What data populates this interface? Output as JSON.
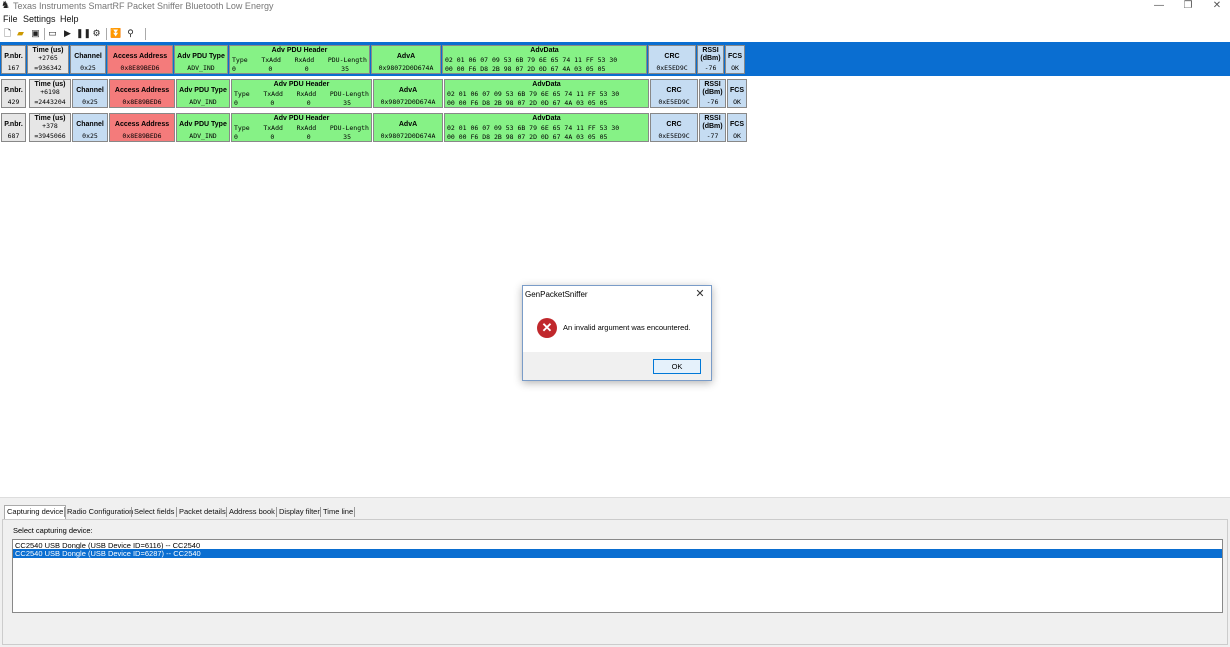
{
  "window": {
    "title": "Texas Instruments SmartRF Packet Sniffer Bluetooth Low Energy",
    "minimize": "—",
    "restore": "❐",
    "close": "✕"
  },
  "menu": [
    "File",
    "Settings",
    "Help"
  ],
  "toolbar": [
    "new-icon",
    "open-icon",
    "save-icon",
    "clear-icon",
    "play-icon",
    "pause-icon",
    "settings-icon",
    "scroll-down-icon",
    "filter-icon"
  ],
  "packets": [
    {
      "pnbr_label": "P.nbr.",
      "pnbr": "167",
      "time_label": "Time (us)",
      "time_delta": "+2765",
      "time_abs": "=936342",
      "channel_label": "Channel",
      "channel": "0x25",
      "aa_label": "Access Address",
      "aa": "0x8E89BED6",
      "pdu_type_label": "Adv PDU Type",
      "pdu_type": "ADV_IND",
      "hdr_label": "Adv PDU Header",
      "hdr_cols": [
        "Type",
        "TxAdd",
        "RxAdd",
        "PDU-Length"
      ],
      "hdr_vals": [
        "0",
        "0",
        "0",
        "35"
      ],
      "adva_label": "AdvA",
      "adva": "0x98072D0D674A",
      "advdata_label": "AdvData",
      "advdata_1": "02 01 06 07 09 53 6B 79 6E 65 74 11 FF 53 30",
      "advdata_2": "00 00 F6 D8 2B 98 07 2D 0D 67 4A 03 05 05",
      "crc_label": "CRC",
      "crc": "0xE5ED9C",
      "rssi_label": "RSSI (dBm)",
      "rssi": "-76",
      "fcs_label": "FCS",
      "fcs": "OK"
    },
    {
      "pnbr_label": "P.nbr.",
      "pnbr": "429",
      "time_label": "Time (us)",
      "time_delta": "+6198",
      "time_abs": "=2443204",
      "channel_label": "Channel",
      "channel": "0x25",
      "aa_label": "Access Address",
      "aa": "0x8E89BED6",
      "pdu_type_label": "Adv PDU Type",
      "pdu_type": "ADV_IND",
      "hdr_label": "Adv PDU Header",
      "hdr_cols": [
        "Type",
        "TxAdd",
        "RxAdd",
        "PDU-Length"
      ],
      "hdr_vals": [
        "0",
        "0",
        "0",
        "35"
      ],
      "adva_label": "AdvA",
      "adva": "0x98072D0D674A",
      "advdata_label": "AdvData",
      "advdata_1": "02 01 06 07 09 53 6B 79 6E 65 74 11 FF 53 30",
      "advdata_2": "00 00 F6 D8 2B 98 07 2D 0D 67 4A 03 05 05",
      "crc_label": "CRC",
      "crc": "0xE5ED9C",
      "rssi_label": "RSSI (dBm)",
      "rssi": "-76",
      "fcs_label": "FCS",
      "fcs": "OK"
    },
    {
      "pnbr_label": "P.nbr.",
      "pnbr": "687",
      "time_label": "Time (us)",
      "time_delta": "+378",
      "time_abs": "=3945066",
      "channel_label": "Channel",
      "channel": "0x25",
      "aa_label": "Access Address",
      "aa": "0x8E89BED6",
      "pdu_type_label": "Adv PDU Type",
      "pdu_type": "ADV_IND",
      "hdr_label": "Adv PDU Header",
      "hdr_cols": [
        "Type",
        "TxAdd",
        "RxAdd",
        "PDU-Length"
      ],
      "hdr_vals": [
        "0",
        "0",
        "0",
        "35"
      ],
      "adva_label": "AdvA",
      "adva": "0x98072D0D674A",
      "advdata_label": "AdvData",
      "advdata_1": "02 01 06 07 09 53 6B 79 6E 65 74 11 FF 53 30",
      "advdata_2": "00 00 F6 D8 2B 98 07 2D 0D 67 4A 03 05 05",
      "crc_label": "CRC",
      "crc": "0xE5ED9C",
      "rssi_label": "RSSI (dBm)",
      "rssi": "-77",
      "fcs_label": "FCS",
      "fcs": "OK"
    }
  ],
  "dialog": {
    "title": "GenPacketSniffer",
    "message": "An invalid argument was encountered.",
    "ok": "OK"
  },
  "tabs": [
    "Capturing device",
    "Radio Configuration",
    "Select fields",
    "Packet details",
    "Address book",
    "Display filter",
    "Time line"
  ],
  "capture": {
    "label": "Select capturing device:",
    "devices": [
      "CC2540 USB Dongle (USB Device ID=6116) -- CC2540",
      "CC2540 USB Dongle (USB Device ID=6287) -- CC2540"
    ]
  },
  "colors": {
    "selection": "#0a6ed1",
    "red_cell": "#f47b7b",
    "green_cell": "#86f286",
    "blue_cell": "#c5dcf2"
  }
}
